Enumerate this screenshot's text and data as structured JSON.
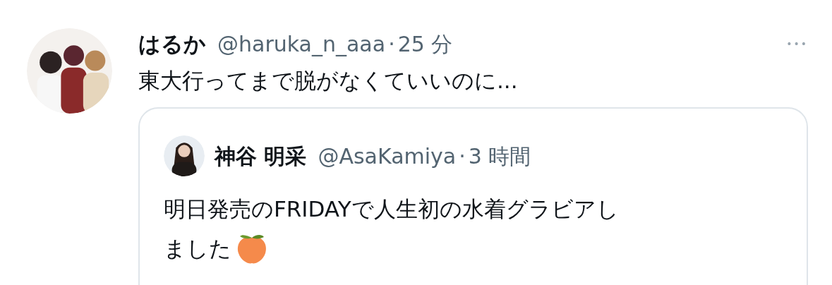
{
  "tweet": {
    "name": "はるか",
    "handle": "@haruka_n_aaa",
    "separator": "·",
    "time": "25 分",
    "more": "•••",
    "text": "東大行ってまで脱がなくていいのに...",
    "quote": {
      "name": "神谷 明采",
      "handle": "@AsaKamiya",
      "separator": "·",
      "time": "3 時間",
      "lines": [
        "明日発売のFRIDAYで人生初の水着グラビアし",
        "ました"
      ]
    }
  }
}
